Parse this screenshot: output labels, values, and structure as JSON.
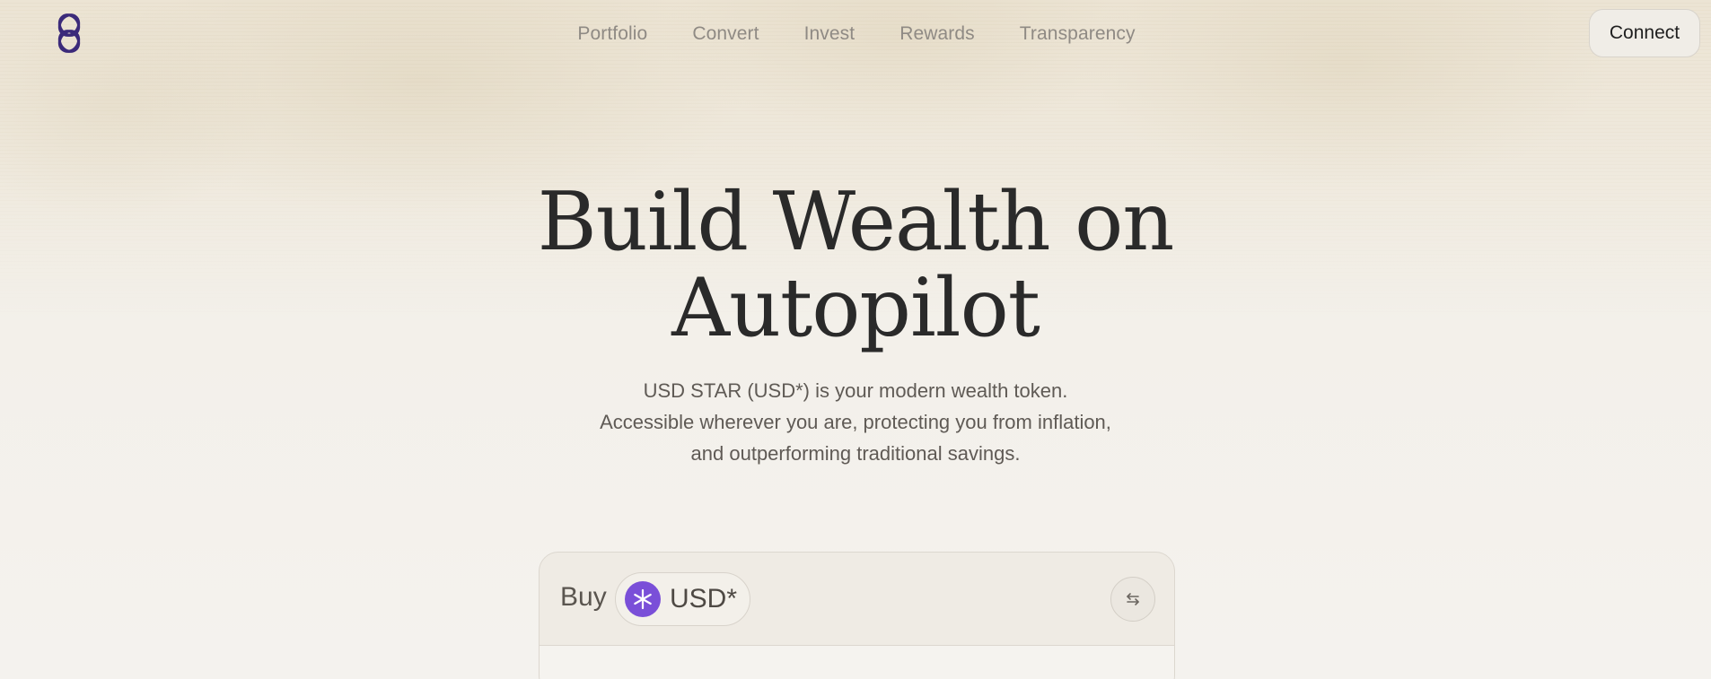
{
  "header": {
    "logo_icon": "interlocked-rings-logo-icon",
    "nav": [
      {
        "label": "Portfolio"
      },
      {
        "label": "Convert"
      },
      {
        "label": "Invest"
      },
      {
        "label": "Rewards"
      },
      {
        "label": "Transparency"
      }
    ],
    "connect_label": "Connect"
  },
  "hero": {
    "title_line1": "Build Wealth on",
    "title_line2": "Autopilot",
    "subtitle_line1": "USD STAR (USD*) is your modern wealth token.",
    "subtitle_line2": "Accessible wherever you are, protecting you from inflation,",
    "subtitle_line3": "and outperforming traditional savings."
  },
  "card": {
    "mode_label": "Buy",
    "token_label": "USD*",
    "token_icon": "star-burst-icon",
    "swap_icon": "swap-arrows-icon"
  },
  "colors": {
    "logo": "#3b2a7a",
    "token_icon_bg": "#7a4fd8",
    "title_text": "#2a2a2a",
    "nav_text": "#8f8a84"
  }
}
